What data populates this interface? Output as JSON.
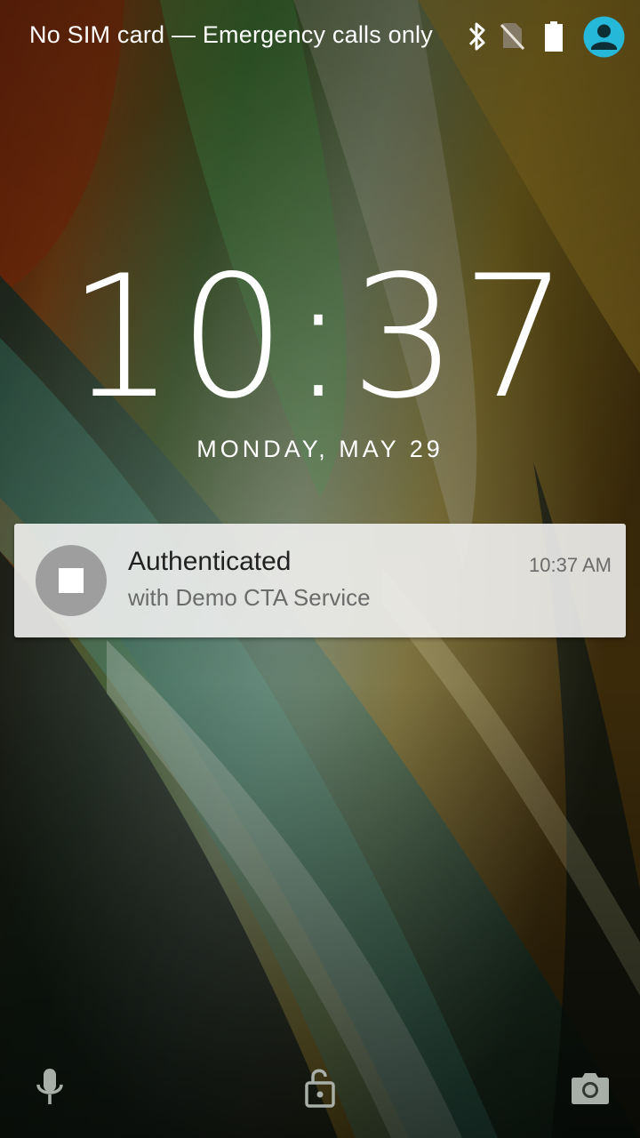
{
  "status_bar": {
    "carrier_text": "No SIM card — Emergency calls only",
    "icons": [
      "bluetooth-icon",
      "no-sim-icon",
      "battery-icon",
      "user-icon"
    ],
    "user_icon_color": "#26b8d8"
  },
  "lockscreen": {
    "time": "10:37",
    "date": "MONDAY, MAY 29"
  },
  "notification": {
    "title": "Authenticated",
    "text": "with Demo CTA Service",
    "time": "10:37 AM",
    "icon": "stop-icon"
  },
  "bottom_affordances": {
    "left": "mic-icon",
    "center": "lock-open-icon",
    "right": "camera-icon"
  }
}
